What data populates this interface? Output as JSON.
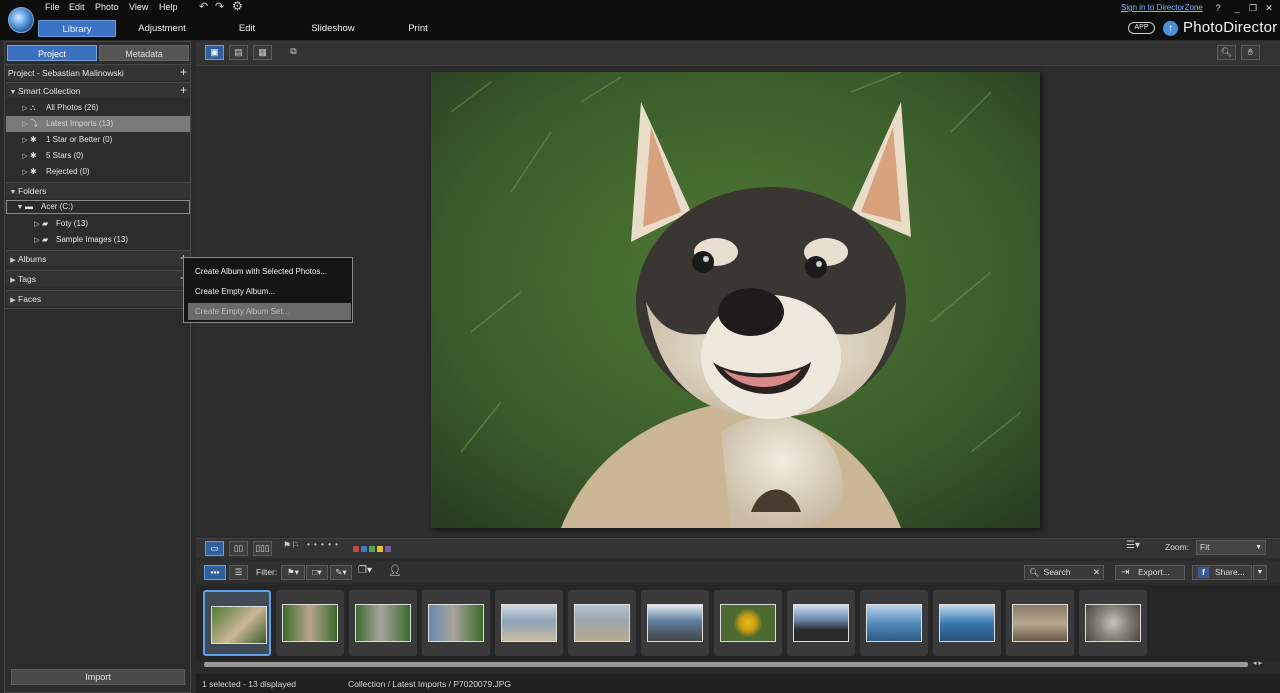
{
  "menu": {
    "file": "File",
    "edit": "Edit",
    "photo": "Photo",
    "view": "View",
    "help": "Help"
  },
  "modes": {
    "library": "Library",
    "adjustment": "Adjustment",
    "edit": "Edit",
    "slideshow": "Slideshow",
    "print": "Print"
  },
  "top_right": {
    "signin": "Sign in to DirectorZone",
    "help": "?",
    "app": "APP",
    "brand": "PhotoDirector"
  },
  "panel": {
    "tabs": {
      "project": "Project",
      "metadata": "Metadata"
    },
    "project_title": "Project - Sebastian Malinowski",
    "smart_collection": "Smart Collection",
    "smart_items": [
      "All Photos (26)",
      "Latest Imports (13)",
      "1 Star or Better (0)",
      "5 Stars (0)",
      "Rejected (0)"
    ],
    "folders": "Folders",
    "folder_root": "Acer (C:)",
    "folder_items": [
      "Foty (13)",
      "Sample Images (13)"
    ],
    "albums": "Albums",
    "tags": "Tags",
    "faces": "Faces",
    "import": "Import"
  },
  "context_menu": [
    "Create Album with Selected Photos...",
    "Create Empty Album...",
    "Create Empty Album Set..."
  ],
  "filterbar": {
    "filter_label": "Filter:",
    "search_placeholder": "Search",
    "export": "Export...",
    "share": "Share..."
  },
  "stripbar": {
    "zoom_label": "Zoom:",
    "zoom_value": "Fit",
    "stars": "• • • • •"
  },
  "color_labels": [
    "#c94a3a",
    "#3f7bc0",
    "#4aa85a",
    "#e0c040",
    "#7a5aa8"
  ],
  "status": {
    "selection": "1 selected - 13 displayed",
    "path": "Collection / Latest Imports / P7020079.JPG"
  }
}
